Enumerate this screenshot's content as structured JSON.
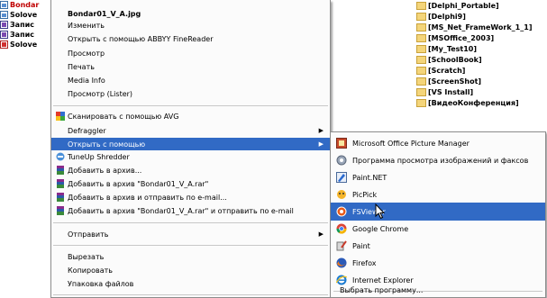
{
  "left_files": [
    {
      "label": "Bondar",
      "selected": true,
      "icon": "jpg-file-icon",
      "color": "#c00000"
    },
    {
      "label": "Solove",
      "selected": false,
      "icon": "jpg-file-icon"
    },
    {
      "label": "Запис",
      "selected": false,
      "icon": "text-file-icon"
    },
    {
      "label": "Запис",
      "selected": false,
      "icon": "text-file-icon"
    },
    {
      "label": "Solove",
      "selected": false,
      "icon": "pdf-file-icon"
    }
  ],
  "right_folders": [
    "[Delphi_Portable]",
    "[Delphi9]",
    "[MS_Net_FrameWork_1_1]",
    "[MSOffice_2003]",
    "[My_Test10]",
    "[SchoolBook]",
    "[Scratch]",
    "[ScreenShot]",
    "[VS Install]",
    "[ВидеоКонференция]"
  ],
  "context_menu": {
    "items": [
      {
        "label": "Bondar01_V_A.jpg",
        "bold": true,
        "icon": ""
      },
      {
        "label": "Изменить",
        "icon": ""
      },
      {
        "label": "Открыть с помощью ABBYY FineReader",
        "icon": ""
      },
      {
        "label": "Просмотр",
        "icon": ""
      },
      {
        "label": "Печать",
        "icon": ""
      },
      {
        "label": "Media Info",
        "icon": ""
      },
      {
        "label": "Просмотр (Lister)",
        "icon": ""
      },
      {
        "label": "Сканировать с помощью AVG",
        "icon": "avg-icon"
      },
      {
        "label": "Defraggler",
        "icon": "",
        "submenu": true
      },
      {
        "label": "Открыть с помощью",
        "icon": "",
        "submenu": true,
        "highlighted": true
      },
      {
        "label": "TuneUp Shredder",
        "icon": "shredder-icon"
      },
      {
        "label": "Добавить в архив...",
        "icon": "winrar-icon"
      },
      {
        "label": "Добавить в архив \"Bondar01_V_A.rar\"",
        "icon": "winrar-icon"
      },
      {
        "label": "Добавить в архив и отправить по e-mail...",
        "icon": "winrar-icon"
      },
      {
        "label": "Добавить в архив \"Bondar01_V_A.rar\" и отправить по e-mail",
        "icon": "winrar-icon"
      },
      {
        "label": "Отправить",
        "icon": "",
        "submenu": true
      },
      {
        "label": "Вырезать",
        "icon": ""
      },
      {
        "label": "Копировать",
        "icon": ""
      },
      {
        "label": "Упаковка файлов",
        "icon": ""
      }
    ],
    "submenu_arrow": "▶"
  },
  "submenu": {
    "items": [
      {
        "label": "Microsoft Office Picture Manager",
        "icon": "picture-manager-icon"
      },
      {
        "label": "Программа просмотра изображений и факсов",
        "icon": "image-viewer-icon"
      },
      {
        "label": "Paint.NET",
        "icon": "paintnet-icon"
      },
      {
        "label": "PicPick",
        "icon": "picpick-icon"
      },
      {
        "label": "FSViewer",
        "icon": "fsviewer-icon",
        "highlighted": true
      },
      {
        "label": "Google Chrome",
        "icon": "chrome-icon"
      },
      {
        "label": "Paint",
        "icon": "paint-icon"
      },
      {
        "label": "Firefox",
        "icon": "firefox-icon"
      },
      {
        "label": "Internet Explorer",
        "icon": "ie-icon"
      }
    ],
    "choose_program": "Выбрать программу..."
  },
  "colors": {
    "highlight": "#316ac5",
    "menu_bg": "#fbfbfb",
    "folder": "#f4d57a"
  }
}
